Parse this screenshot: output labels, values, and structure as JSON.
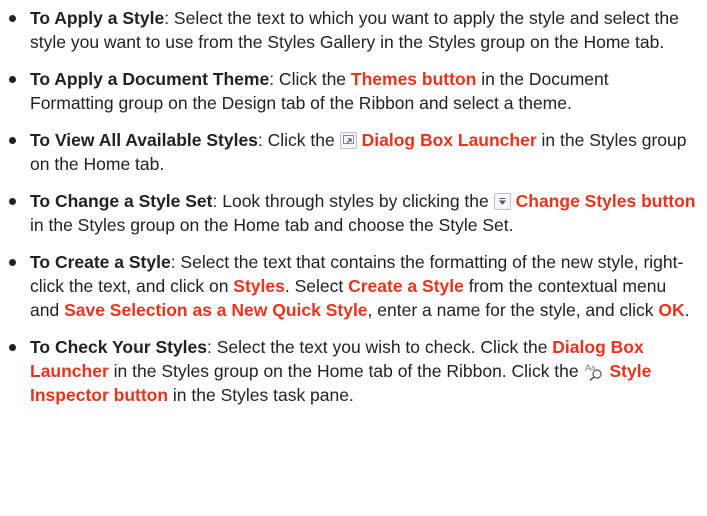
{
  "items": [
    {
      "title": "To Apply a Style",
      "text1": ": Select the text to which you want to apply the style and select the style you want to use from the Styles Gallery in the Styles group on the Home tab."
    },
    {
      "title": "To Apply a Document Theme",
      "text1": ": Click the ",
      "hl1": "Themes button",
      "text2": " in the Document Formatting group on the Design tab of the Ribbon and select a theme."
    },
    {
      "title": "To View All Available Styles",
      "text1": ": Click the ",
      "icon": "dialog-box-launcher-icon",
      "hl1": "Dialog Box Launcher",
      "text2": " in the Styles group on the Home tab."
    },
    {
      "title": "To Change a Style Set",
      "text1": ": Look through styles by clicking the ",
      "icon": "dropdown-arrow-icon",
      "hl1": "Change Styles button",
      "text2": " in the Styles group on the Home tab and choose the Style Set."
    },
    {
      "title": "To Create a Style",
      "text1": ": Select the text that contains the formatting of the new style, right-click the text, and click on ",
      "hl1": "Styles",
      "text2": ". Select ",
      "hl2": "Create a Style",
      "text3": " from the contextual menu and ",
      "hl3": "Save Selection as a New Quick Style",
      "text4": ", enter a name for the style, and click ",
      "hl4": "OK",
      "text5": "."
    },
    {
      "title": "To Check Your Styles",
      "text1": ": Select the text you wish to check. Click the ",
      "hl1": "Dialog Box Launcher",
      "text2": " in the Styles group on the Home tab of the Ribbon. Click the ",
      "icon": "style-inspector-icon",
      "hl2": "Style Inspector button",
      "text3": " in the Styles task pane."
    }
  ]
}
